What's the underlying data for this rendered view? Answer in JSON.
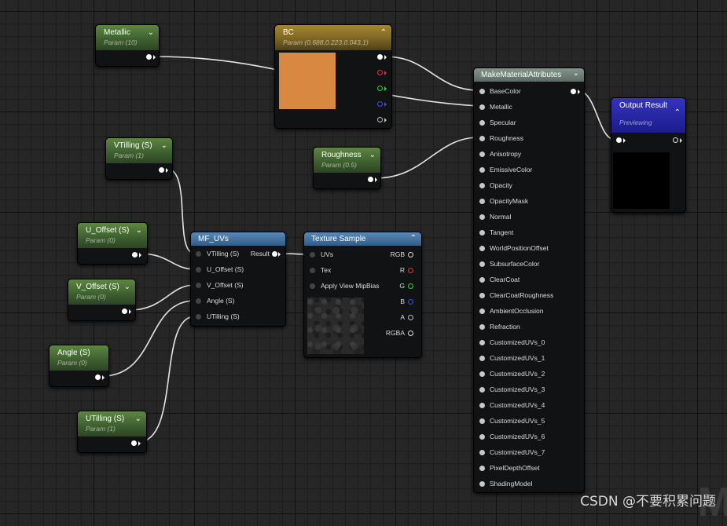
{
  "nodes": {
    "metallic": {
      "title": "Metallic",
      "subtitle": "Param (10)"
    },
    "bc": {
      "title": "BC",
      "subtitle": "Param (0.688,0.223,0.043,1)",
      "preview_color": "#d98841"
    },
    "vtilling": {
      "title": "VTilling (S)",
      "subtitle": "Param (1)"
    },
    "roughness": {
      "title": "Roughness",
      "subtitle": "Param (0.5)"
    },
    "uoffset": {
      "title": "U_Offset (S)",
      "subtitle": "Param (0)"
    },
    "voffset": {
      "title": "V_Offset (S)",
      "subtitle": "Param (0)"
    },
    "angle": {
      "title": "Angle (S)",
      "subtitle": "Param (0)"
    },
    "utilling": {
      "title": "UTilling (S)",
      "subtitle": "Param (1)"
    },
    "mfuvs": {
      "title": "MF_UVs",
      "inputs": [
        "VTilling (S)",
        "U_Offset (S)",
        "V_Offset (S)",
        "Angle (S)",
        "UTilling (S)"
      ],
      "output": "Result"
    },
    "texture": {
      "title": "Texture Sample",
      "inputs": [
        "UVs",
        "Tex",
        "Apply View MipBias"
      ],
      "outputs": [
        "RGB",
        "R",
        "G",
        "B",
        "A",
        "RGBA"
      ]
    },
    "mma": {
      "title": "MakeMaterialAttributes",
      "inputs": [
        "BaseColor",
        "Metallic",
        "Specular",
        "Roughness",
        "Anisotropy",
        "EmissiveColor",
        "Opacity",
        "OpacityMask",
        "Normal",
        "Tangent",
        "WorldPositionOffset",
        "SubsurfaceColor",
        "ClearCoat",
        "ClearCoatRoughness",
        "AmbientOcclusion",
        "Refraction",
        "CustomizedUVs_0",
        "CustomizedUVs_1",
        "CustomizedUVs_2",
        "CustomizedUVs_3",
        "CustomizedUVs_4",
        "CustomizedUVs_5",
        "CustomizedUVs_6",
        "CustomizedUVs_7",
        "PixelDepthOffset",
        "ShadingModel"
      ]
    },
    "output": {
      "title": "Output Result",
      "subtitle": "Previewing"
    }
  },
  "icons": {
    "collapse": "chevron-down-icon",
    "expand": "chevron-up-icon"
  },
  "watermark": "CSDN @不要积累问题",
  "colors": {
    "wire": "#e4e4e4",
    "param_header": "#4e7438",
    "bc_header": "#8a7029",
    "function_header": "#5a89b7",
    "output_header": "#22229a"
  }
}
